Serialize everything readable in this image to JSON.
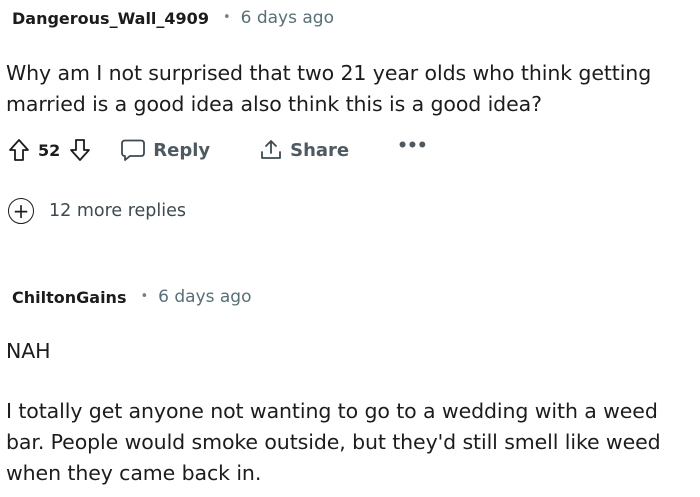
{
  "comments": [
    {
      "author": "Dangerous_Wall_4909",
      "separator": "•",
      "age": "6 days ago",
      "paragraphs": [
        "Why am I not surprised that two 21 year olds who think getting married is a good idea also think this is a good idea?"
      ],
      "score": "52",
      "actions": {
        "reply_label": "Reply",
        "share_label": "Share",
        "more_label": "•••",
        "upvote_icon": "arrow-up-outline-icon",
        "downvote_icon": "arrow-down-outline-icon",
        "reply_icon": "speech-bubble-icon",
        "share_icon": "share-upload-icon"
      },
      "more_replies": {
        "icon": "plus-circle-icon",
        "symbol": "+",
        "label": "12 more replies"
      }
    },
    {
      "author": "ChiltonGains",
      "separator": "•",
      "age": "6 days ago",
      "paragraphs": [
        "NAH",
        "I totally get anyone not wanting to go to a wedding with a weed bar. People would smoke outside, but they'd still smell like weed when they came back in."
      ]
    }
  ],
  "colors": {
    "text": "#1c1c1c",
    "meta": "#576f76",
    "action": "#4e5a60",
    "background": "#ffffff"
  }
}
